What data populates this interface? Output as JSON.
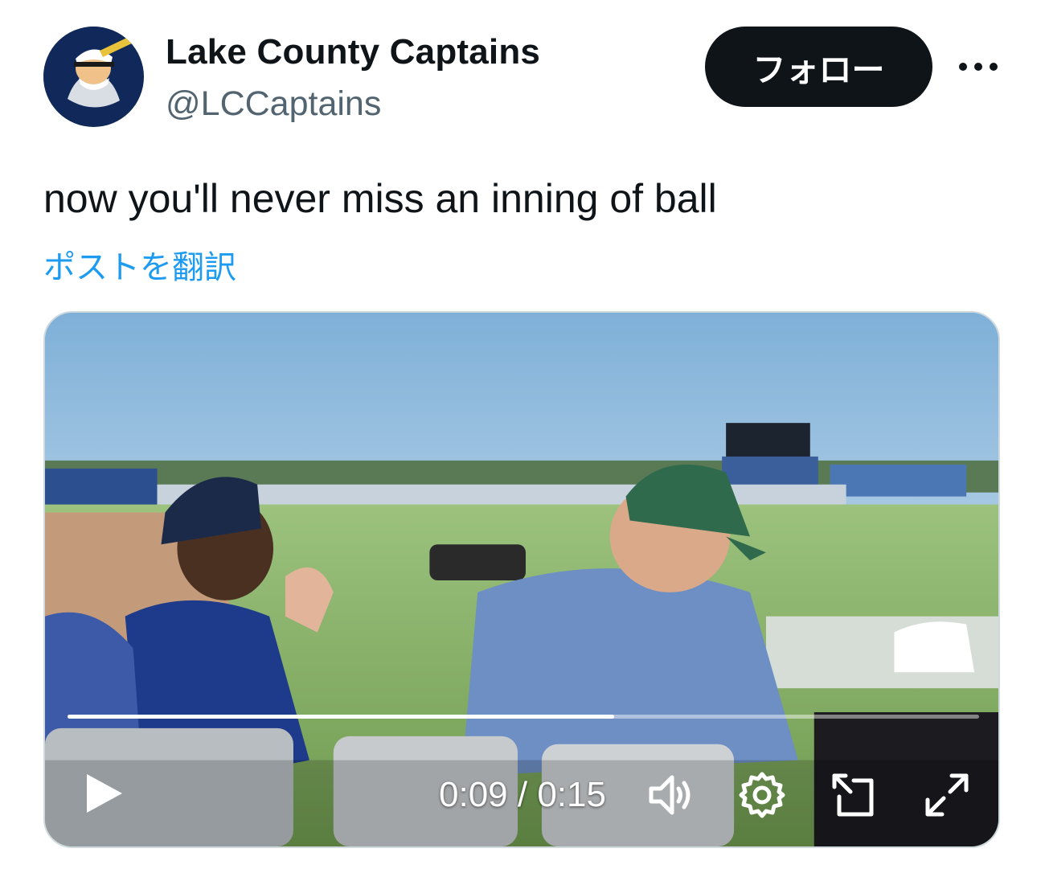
{
  "tweet": {
    "author_name": "Lake County Captains",
    "author_handle": "@LCCaptains",
    "follow_label": "フォロー",
    "text": "now you'll never miss an inning of ball",
    "translate_label": "ポストを翻訳"
  },
  "video": {
    "current_time": "0:09",
    "separator": " / ",
    "duration": "0:15",
    "progress": 0.6,
    "icons": [
      "play-icon",
      "volume-icon",
      "settings-gear-icon",
      "pop-out-icon",
      "fullscreen-icon"
    ]
  },
  "colors": {
    "text": "#0f1419",
    "secondary": "#536471",
    "link": "#1d9bf0",
    "follow_bg": "#0f1419"
  }
}
